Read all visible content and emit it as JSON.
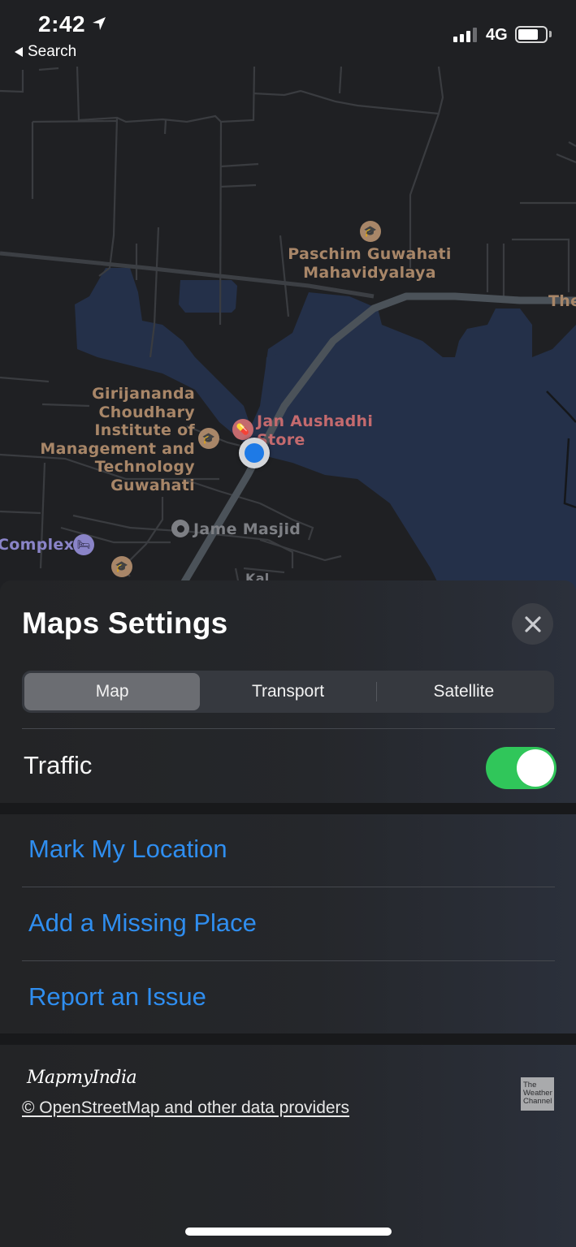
{
  "status_bar": {
    "time": "2:42",
    "back_label": "Search",
    "network": "4G",
    "signal_bars_on": 3,
    "signal_bars_total": 4,
    "battery_level": 0.75
  },
  "map": {
    "labels": {
      "paschim": [
        "Paschim Guwahati",
        "Mahavidyalaya"
      ],
      "girijananda": [
        "Girijananda",
        "Choudhary",
        "Institute of",
        "Management and",
        "Technology",
        "Guwahati"
      ],
      "jan_aushadhi": [
        "Jan Aushadhi",
        "Store"
      ],
      "jame_masjid": "Jame Masjid",
      "complex": "Complex",
      "the_partial": "The",
      "kal_partial": "Kal"
    },
    "colors": {
      "land": "#1f2023",
      "water": "#243049",
      "road": "#4b5259",
      "education_poi": "#a88668",
      "health_poi": "#c46a6e",
      "user_location": "#1e7ae6"
    }
  },
  "sheet": {
    "title": "Maps Settings",
    "map_types": [
      {
        "label": "Map",
        "selected": true
      },
      {
        "label": "Transport",
        "selected": false
      },
      {
        "label": "Satellite",
        "selected": false
      }
    ],
    "traffic_label": "Traffic",
    "traffic_enabled": true,
    "actions": [
      "Mark My Location",
      "Add a Missing Place",
      "Report an Issue"
    ],
    "logo_text": "MapmyIndia",
    "attribution": "© OpenStreetMap and other data providers",
    "weather_logo": [
      "The",
      "Weather",
      "Channel"
    ],
    "colors": {
      "action_blue": "#2f8ef0",
      "toggle_on": "#30c65a"
    }
  }
}
